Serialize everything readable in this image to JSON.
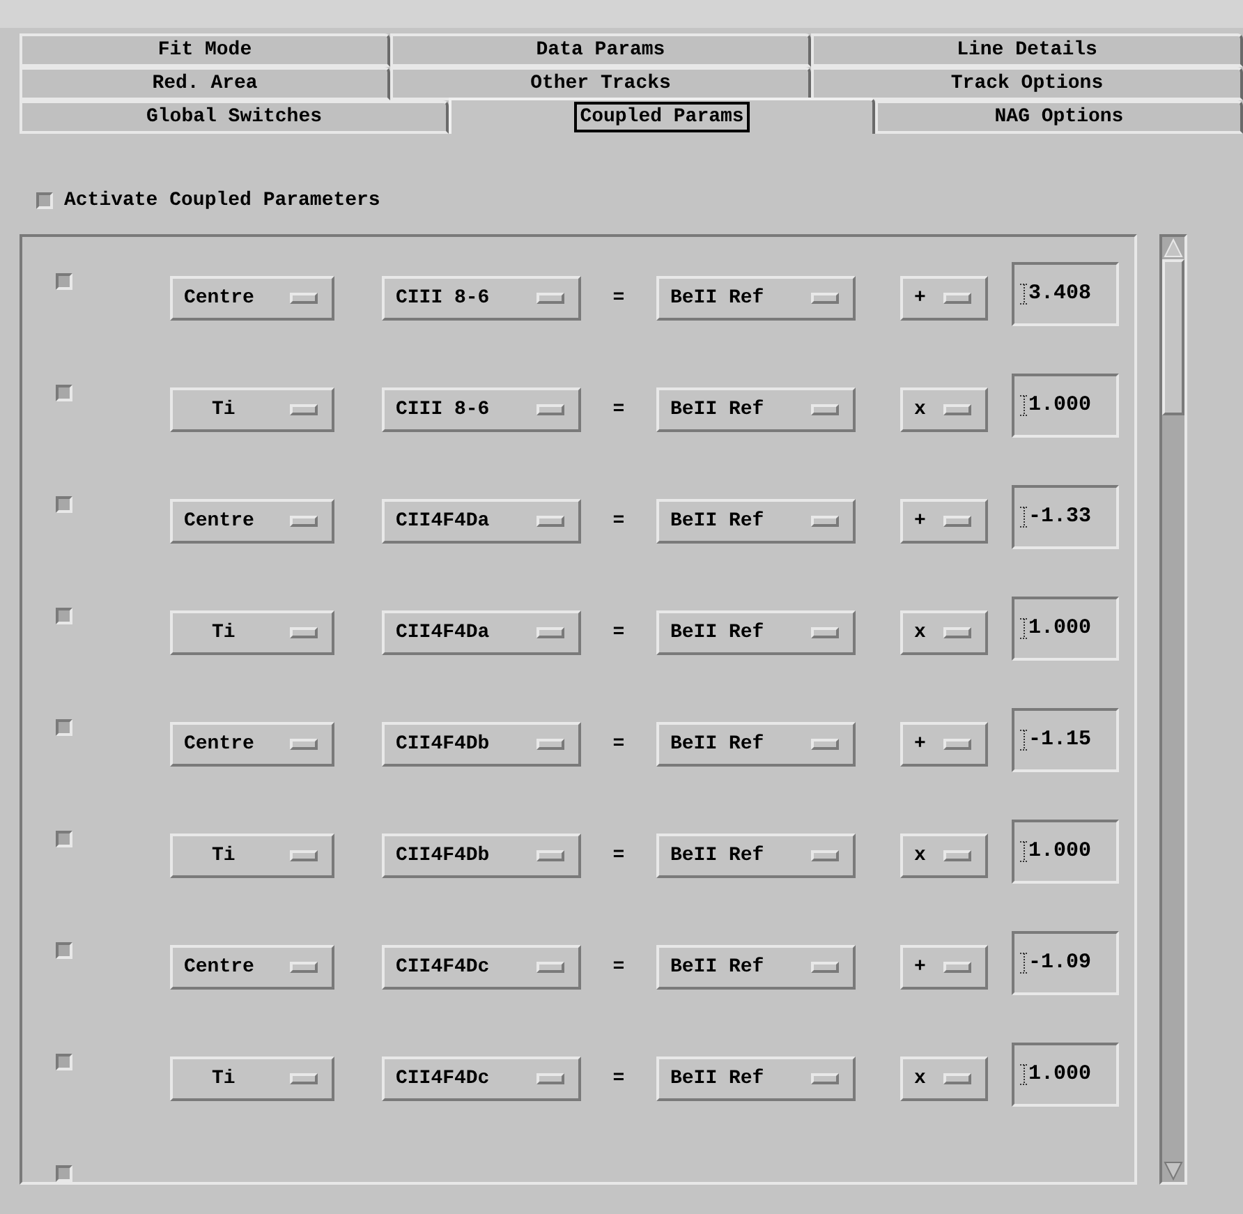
{
  "tab_rows": [
    [
      {
        "label": "Fit Mode",
        "selected": false
      },
      {
        "label": "Data Params",
        "selected": false
      },
      {
        "label": "Line Details",
        "selected": false
      }
    ],
    [
      {
        "label": "Red. Area",
        "selected": false
      },
      {
        "label": "Other Tracks",
        "selected": false
      },
      {
        "label": "Track Options",
        "selected": false
      }
    ],
    [
      {
        "label": "Global Switches",
        "selected": false
      },
      {
        "label": "Coupled Params",
        "selected": true
      },
      {
        "label": "NAG Options",
        "selected": false
      }
    ]
  ],
  "activate": {
    "label": "Activate Coupled Parameters",
    "checked": false
  },
  "rows": [
    {
      "checked": false,
      "param": "Centre",
      "line": "CIII 8-6",
      "equals": "=",
      "reference": "BeII Ref",
      "op": "+",
      "value": "3.408"
    },
    {
      "checked": false,
      "param": "Ti",
      "line": "CIII 8-6",
      "equals": "=",
      "reference": "BeII Ref",
      "op": "x",
      "value": "1.000"
    },
    {
      "checked": false,
      "param": "Centre",
      "line": "CII4F4Da",
      "equals": "=",
      "reference": "BeII Ref",
      "op": "+",
      "value": "-1.33"
    },
    {
      "checked": false,
      "param": "Ti",
      "line": "CII4F4Da",
      "equals": "=",
      "reference": "BeII Ref",
      "op": "x",
      "value": "1.000"
    },
    {
      "checked": false,
      "param": "Centre",
      "line": "CII4F4Db",
      "equals": "=",
      "reference": "BeII Ref",
      "op": "+",
      "value": "-1.15"
    },
    {
      "checked": false,
      "param": "Ti",
      "line": "CII4F4Db",
      "equals": "=",
      "reference": "BeII Ref",
      "op": "x",
      "value": "1.000"
    },
    {
      "checked": false,
      "param": "Centre",
      "line": "CII4F4Dc",
      "equals": "=",
      "reference": "BeII Ref",
      "op": "+",
      "value": "-1.09"
    },
    {
      "checked": false,
      "param": "Ti",
      "line": "CII4F4Dc",
      "equals": "=",
      "reference": "BeII Ref",
      "op": "x",
      "value": "1.000"
    }
  ],
  "clipped_row": {
    "checked": false
  }
}
